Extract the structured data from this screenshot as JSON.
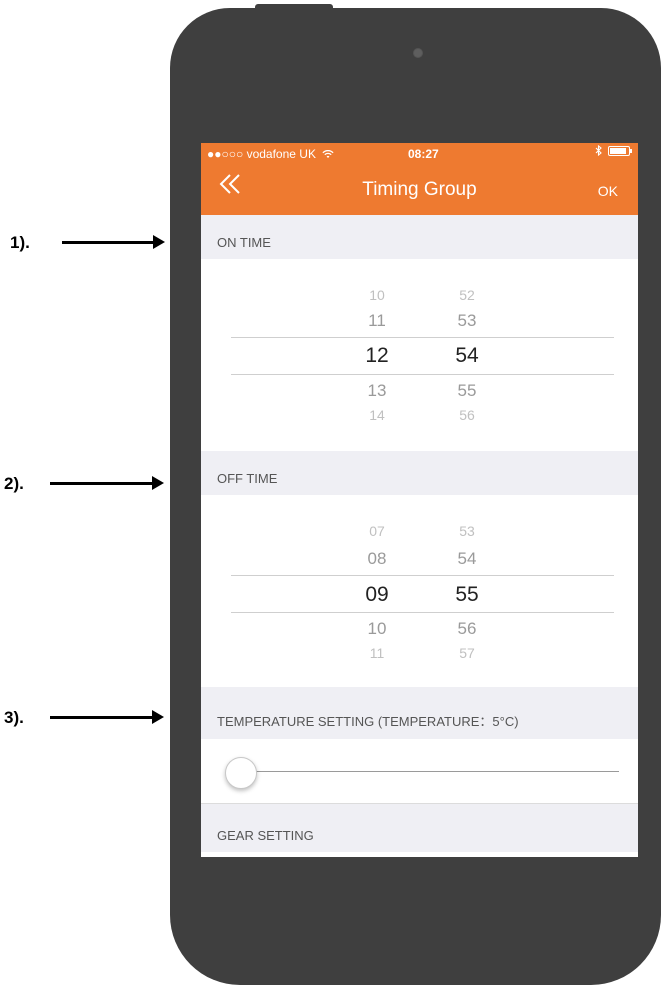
{
  "annotations": [
    {
      "label": "1)."
    },
    {
      "label": "2)."
    },
    {
      "label": "3)."
    }
  ],
  "status_bar": {
    "carrier": "●●○○○ vodafone UK",
    "wifi_icon": "wifi-icon",
    "time": "08:27",
    "bluetooth_icon": "bluetooth-icon",
    "battery_icon": "battery-icon"
  },
  "nav": {
    "back_icon": "double-chevron-left-icon",
    "title": "Timing Group",
    "ok_label": "OK"
  },
  "colors": {
    "accent": "#ee7a30",
    "background": "#efeff4",
    "slider_fill": "#2a7ae2"
  },
  "on_time": {
    "header": "ON TIME",
    "hours": [
      "10",
      "11",
      "12",
      "13",
      "14"
    ],
    "minutes": [
      "52",
      "53",
      "54",
      "55",
      "56"
    ],
    "selected_hour": "12",
    "selected_minute": "54"
  },
  "off_time": {
    "header": "OFF TIME",
    "hours": [
      "07",
      "08",
      "09",
      "10",
      "11"
    ],
    "minutes": [
      "53",
      "54",
      "55",
      "56",
      "57"
    ],
    "selected_hour": "09",
    "selected_minute": "55"
  },
  "temperature": {
    "header": "TEMPERATURE SETTING (TEMPERATURE：5°C)",
    "slider_value": 0.0
  },
  "gear": {
    "header": "GEAR SETTING"
  }
}
